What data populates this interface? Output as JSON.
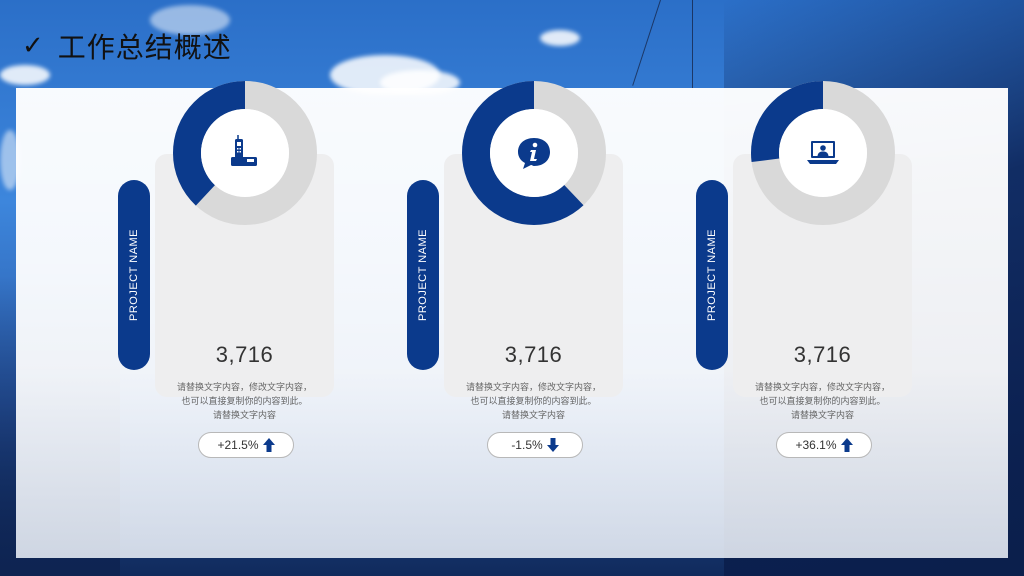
{
  "title": "工作总结概述",
  "colors": {
    "accent": "#0b3a8c",
    "ring_bg": "#d9d9d9"
  },
  "cards": [
    {
      "side_label": "PROJECT NAME",
      "value": "3,716",
      "percent_fill": 0.38,
      "icon": "cordless-phone-icon",
      "desc_line1": "请替换文字内容，修改文字内容，",
      "desc_line2": "也可以直接复制你的内容到此。",
      "desc_line3": "请替换文字内容",
      "change": "+21.5%",
      "trend": "up"
    },
    {
      "side_label": "PROJECT NAME",
      "value": "3,716",
      "percent_fill": 0.62,
      "icon": "info-chat-icon",
      "desc_line1": "请替换文字内容，修改文字内容，",
      "desc_line2": "也可以直接复制你的内容到此。",
      "desc_line3": "请替换文字内容",
      "change": "-1.5%",
      "trend": "down"
    },
    {
      "side_label": "PROJECT NAME",
      "value": "3,716",
      "percent_fill": 0.27,
      "icon": "laptop-user-icon",
      "desc_line1": "请替换文字内容，修改文字内容，",
      "desc_line2": "也可以直接复制你的内容到此。",
      "desc_line3": "请替换文字内容",
      "change": "+36.1%",
      "trend": "up"
    }
  ]
}
